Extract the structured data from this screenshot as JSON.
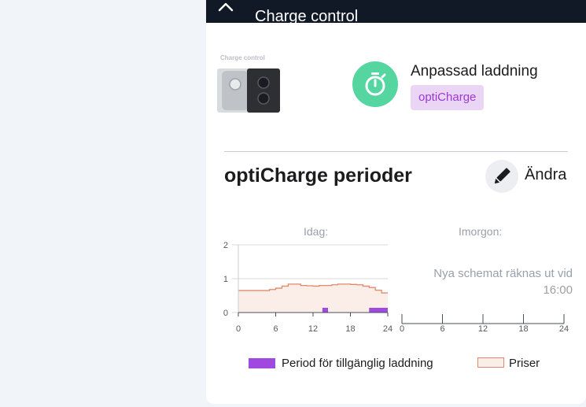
{
  "header": {
    "title": "Charge control"
  },
  "device": {
    "label": "Charge control"
  },
  "mode": {
    "title": "Anpassad laddning",
    "badge": "optiCharge"
  },
  "section": {
    "title": "optiCharge perioder",
    "edit_label": "Ändra"
  },
  "charts": {
    "today_label": "Idag:",
    "tomorrow_label": "Imorgon:",
    "tomorrow_note_line1": "Nya schemat räknas ut vid",
    "tomorrow_note_line2": "16:00"
  },
  "legend": {
    "period_label": "Period för tillgänglig laddning",
    "price_label": "Priser"
  },
  "colors": {
    "header_bg": "#111826",
    "accent_green": "#55d5a0",
    "badge_bg": "#ead5f5",
    "badge_text": "#9a3ad0",
    "period_purple": "#a049e0",
    "price_line": "#e08a6a",
    "price_fill": "#fbeee8"
  },
  "chart_data": [
    {
      "type": "area",
      "title": "Idag:",
      "x_ticks": [
        "0",
        "6",
        "12",
        "18",
        "24"
      ],
      "y_ticks": [
        "0",
        "1",
        "2"
      ],
      "xlim": [
        0,
        24
      ],
      "ylim": [
        0,
        2
      ],
      "series": [
        {
          "name": "Priser",
          "step": true,
          "x": [
            0,
            1,
            2,
            3,
            4,
            5,
            6,
            7,
            8,
            9,
            10,
            11,
            12,
            13,
            14,
            15,
            16,
            17,
            18,
            19,
            20,
            21,
            22,
            23
          ],
          "values": [
            0.65,
            0.65,
            0.65,
            0.65,
            0.65,
            0.68,
            0.72,
            0.78,
            0.84,
            0.84,
            0.8,
            0.79,
            0.78,
            0.8,
            0.8,
            0.82,
            0.84,
            0.84,
            0.83,
            0.82,
            0.78,
            0.74,
            0.66,
            0.58
          ]
        }
      ],
      "charging_periods": [
        {
          "name": "Period för tillgänglig laddning",
          "start": 13.5,
          "end": 14.4
        },
        {
          "name": "Period för tillgänglig laddning",
          "start": 21.0,
          "end": 24.0
        }
      ]
    },
    {
      "type": "area",
      "title": "Imorgon:",
      "x_ticks": [
        "0",
        "6",
        "12",
        "18",
        "24"
      ],
      "xlim": [
        0,
        24
      ],
      "series": []
    }
  ]
}
